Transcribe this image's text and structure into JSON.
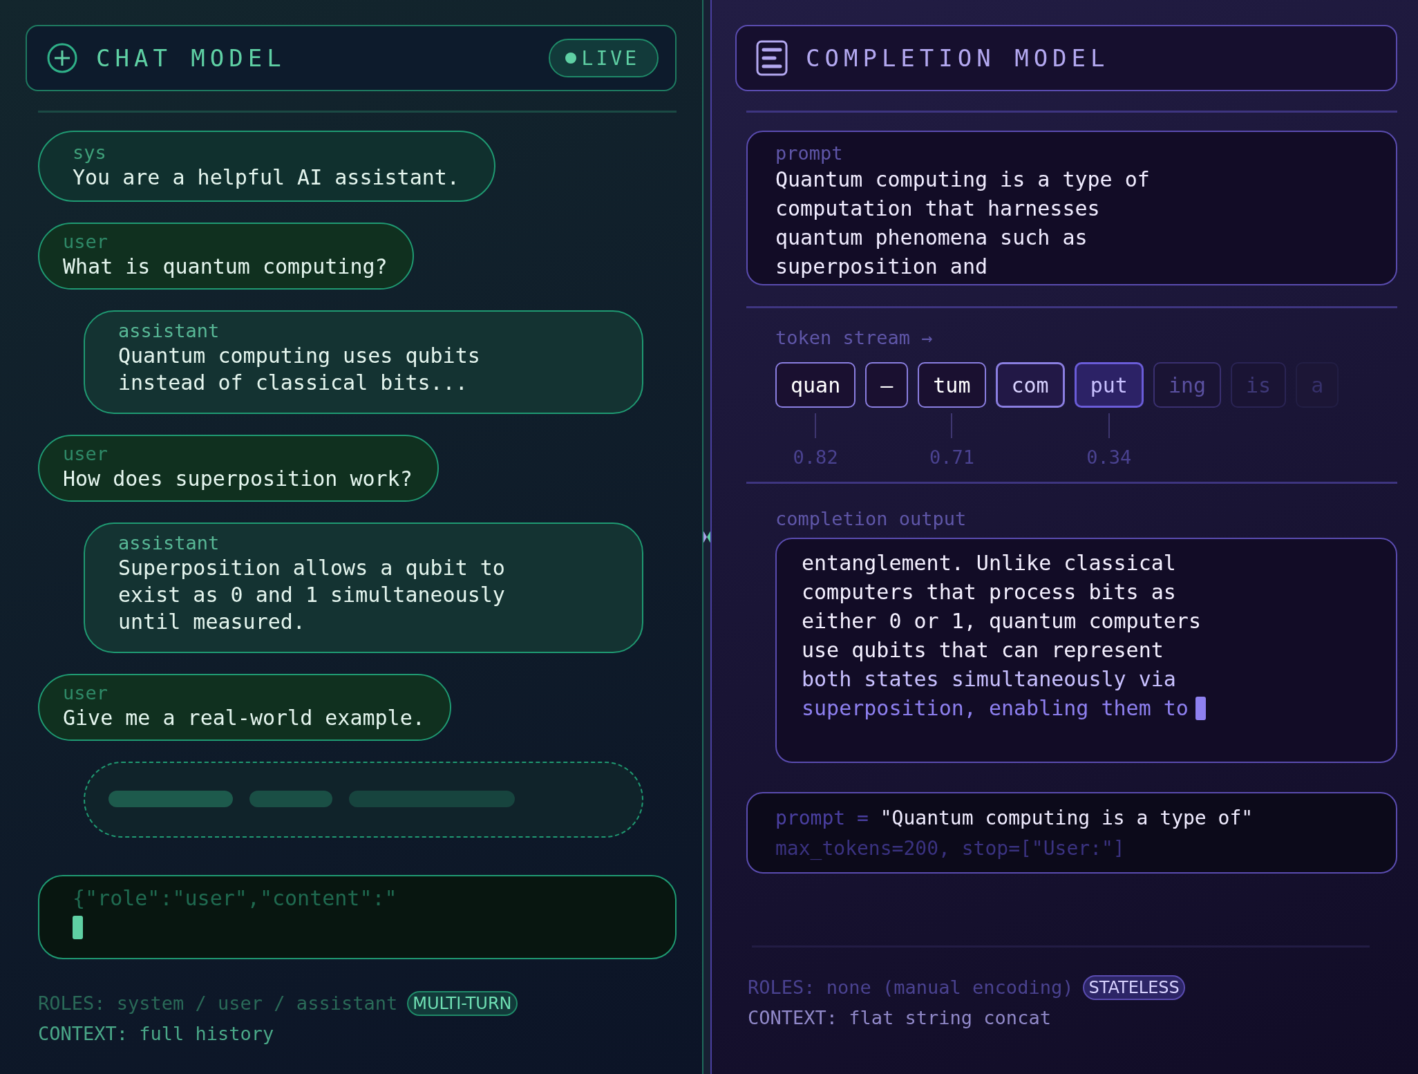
{
  "chat_panel": {
    "title": "CHAT MODEL",
    "status": "LIVE",
    "messages": [
      {
        "kind": "system",
        "role": "sys",
        "text": "You are a helpful AI assistant."
      },
      {
        "kind": "user",
        "role": "user",
        "text": "What is quantum computing?"
      },
      {
        "kind": "assistant",
        "role": "assistant",
        "text": "Quantum computing uses qubits\ninstead of classical bits..."
      },
      {
        "kind": "user",
        "role": "user",
        "text": "How does superposition work?"
      },
      {
        "kind": "assistant",
        "role": "assistant",
        "text": "Superposition allows a qubit to\nexist as 0 and 1 simultaneously\nuntil measured."
      },
      {
        "kind": "user",
        "role": "user",
        "text": "Give me a real-world example."
      },
      {
        "kind": "typing"
      }
    ],
    "input": {
      "value": "{\"role\":\"user\",\"content\":\""
    },
    "footer": {
      "roles": "ROLES: system / user / assistant",
      "context": "CONTEXT: full history",
      "badge": "MULTI-TURN"
    }
  },
  "completion_panel": {
    "title": "COMPLETION MODEL",
    "prompt": {
      "label": "prompt",
      "text": "Quantum computing is a type of\ncomputation that harnesses\nquantum phenomena such as\nsuperposition and"
    },
    "token_stream": {
      "label": "token stream →",
      "tokens": [
        {
          "text": "quan",
          "kind": "emitted",
          "prob": "0.82"
        },
        {
          "text": "–",
          "kind": "emitted"
        },
        {
          "text": "tum",
          "kind": "emitted",
          "prob": "0.71"
        },
        {
          "text": "com",
          "kind": "recent"
        },
        {
          "text": "put",
          "kind": "current",
          "prob": "0.34"
        },
        {
          "text": "ing",
          "kind": "pending"
        },
        {
          "text": "is",
          "kind": "faint"
        },
        {
          "text": "a",
          "kind": "ghost"
        }
      ]
    },
    "output": {
      "label": "completion output",
      "lines": [
        {
          "text": "entanglement. Unlike classical",
          "kind": "settled"
        },
        {
          "text": "computers that process bits as",
          "kind": "settled"
        },
        {
          "text": "either 0 or 1, quantum computers",
          "kind": "settled"
        },
        {
          "text": "use qubits that can represent",
          "kind": "settled"
        },
        {
          "text": "both states simultaneously via",
          "kind": "fresh"
        },
        {
          "text": "superposition, enabling them to",
          "kind": "streaming"
        }
      ]
    },
    "code": {
      "keyword": "prompt =",
      "value": "\"Quantum computing is a type of\"",
      "params": "max_tokens=200, stop=[\"User:\"]"
    },
    "footer": {
      "roles": "ROLES: none (manual encoding)",
      "context": "CONTEXT: flat string concat",
      "badge": "STATELESS"
    }
  }
}
